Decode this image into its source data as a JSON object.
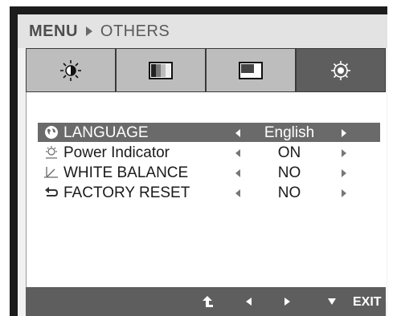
{
  "header": {
    "menu": "MENU",
    "section": "OTHERS"
  },
  "tabs": [
    {
      "name": "picture",
      "icon": "brightness-sun-icon",
      "selected": false
    },
    {
      "name": "color",
      "icon": "color-bars-icon",
      "selected": false
    },
    {
      "name": "display",
      "icon": "screen-position-icon",
      "selected": false
    },
    {
      "name": "others",
      "icon": "gear-icon",
      "selected": true
    }
  ],
  "items": [
    {
      "label": "LANGUAGE",
      "value": "English",
      "icon": "globe-icon",
      "selected": true
    },
    {
      "label": "Power Indicator",
      "value": "ON",
      "icon": "power-indicator-icon",
      "selected": false
    },
    {
      "label": "WHITE BALANCE",
      "value": "NO",
      "icon": "white-balance-icon",
      "selected": false
    },
    {
      "label": "FACTORY RESET",
      "value": "NO",
      "icon": "reset-arrow-icon",
      "selected": false
    }
  ],
  "footer": {
    "exit_label": "EXIT"
  },
  "colors": {
    "selected_bg": "#6a6a6a",
    "tab_bg": "#bdbdbd",
    "footer_bg": "#5e5e5e"
  }
}
